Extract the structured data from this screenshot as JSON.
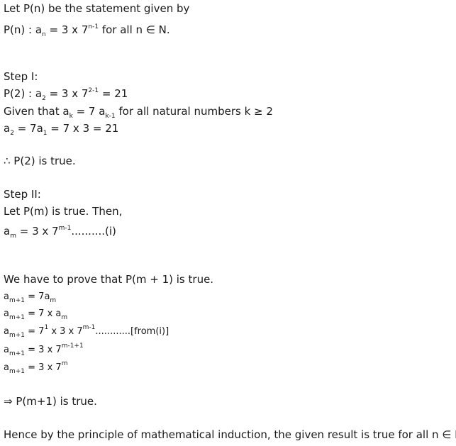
{
  "intro": {
    "line1": "Let P(n) be the statement given by",
    "line2": {
      "lead": "P(n) : a",
      "sub": "n",
      "mid": " = 3 x 7",
      "sup": "n-1",
      "tail": " for all  n ∈ N."
    }
  },
  "step1": {
    "heading": "Step I:",
    "line1": {
      "lead": "P(2) : a",
      "sub": "2",
      "mid": " = 3 x 7",
      "sup": "2-1",
      "tail": " = 21"
    },
    "line2": {
      "lead": "Given that a",
      "sub1": "k",
      "mid": "  =  7  a",
      "sub2": "k-1",
      "tail": "  for all natural numbers k ≥ 2"
    },
    "line3": {
      "lead": "a",
      "sub1": "2",
      "mid": " = 7a",
      "sub2": "1",
      "tail": " = 7 x 3 = 21"
    },
    "conclusion": "∴ P(2) is true."
  },
  "step2": {
    "heading": "Step II:",
    "assume": "Let P(m) is true. Then,",
    "eq_i": {
      "lead": "a",
      "sub": "m",
      "mid": " = 3 x 7",
      "sup": "m-1",
      "tail": "..........(i)"
    },
    "prove": "We have to prove that P(m + 1) is true.",
    "eqs": [
      {
        "lhs": "a",
        "lhs_sub": "m+1",
        "rhs": " = 7a",
        "rhs_sub": "m",
        "rhs_sup": "",
        "tail": ""
      },
      {
        "lhs": "a",
        "lhs_sub": "m+1",
        "rhs": " = 7 x a",
        "rhs_sub": "m",
        "rhs_sup": "",
        "tail": ""
      },
      {
        "lhs": "a",
        "lhs_sub": "m+1",
        "rhs": " = 7",
        "rhs_sub": "",
        "rhs_sup": "1",
        "tail": " x 3 x 7"
      },
      {
        "lhs": "a",
        "lhs_sub": "m+1",
        "rhs": " = 3 x 7",
        "rhs_sub": "",
        "rhs_sup": "m-1+1",
        "tail": ""
      },
      {
        "lhs": "a",
        "lhs_sub": "m+1",
        "rhs": " = 3 x 7",
        "rhs_sub": "",
        "rhs_sup": "m",
        "tail": ""
      }
    ],
    "eq3_sup2": "m-1",
    "eq3_ref": "............[from(i)]",
    "conclusion": "⇒ P(m+1)  is true."
  },
  "final": "Hence by the principle of mathematical induction, the given result is true for all  n ∈ N."
}
